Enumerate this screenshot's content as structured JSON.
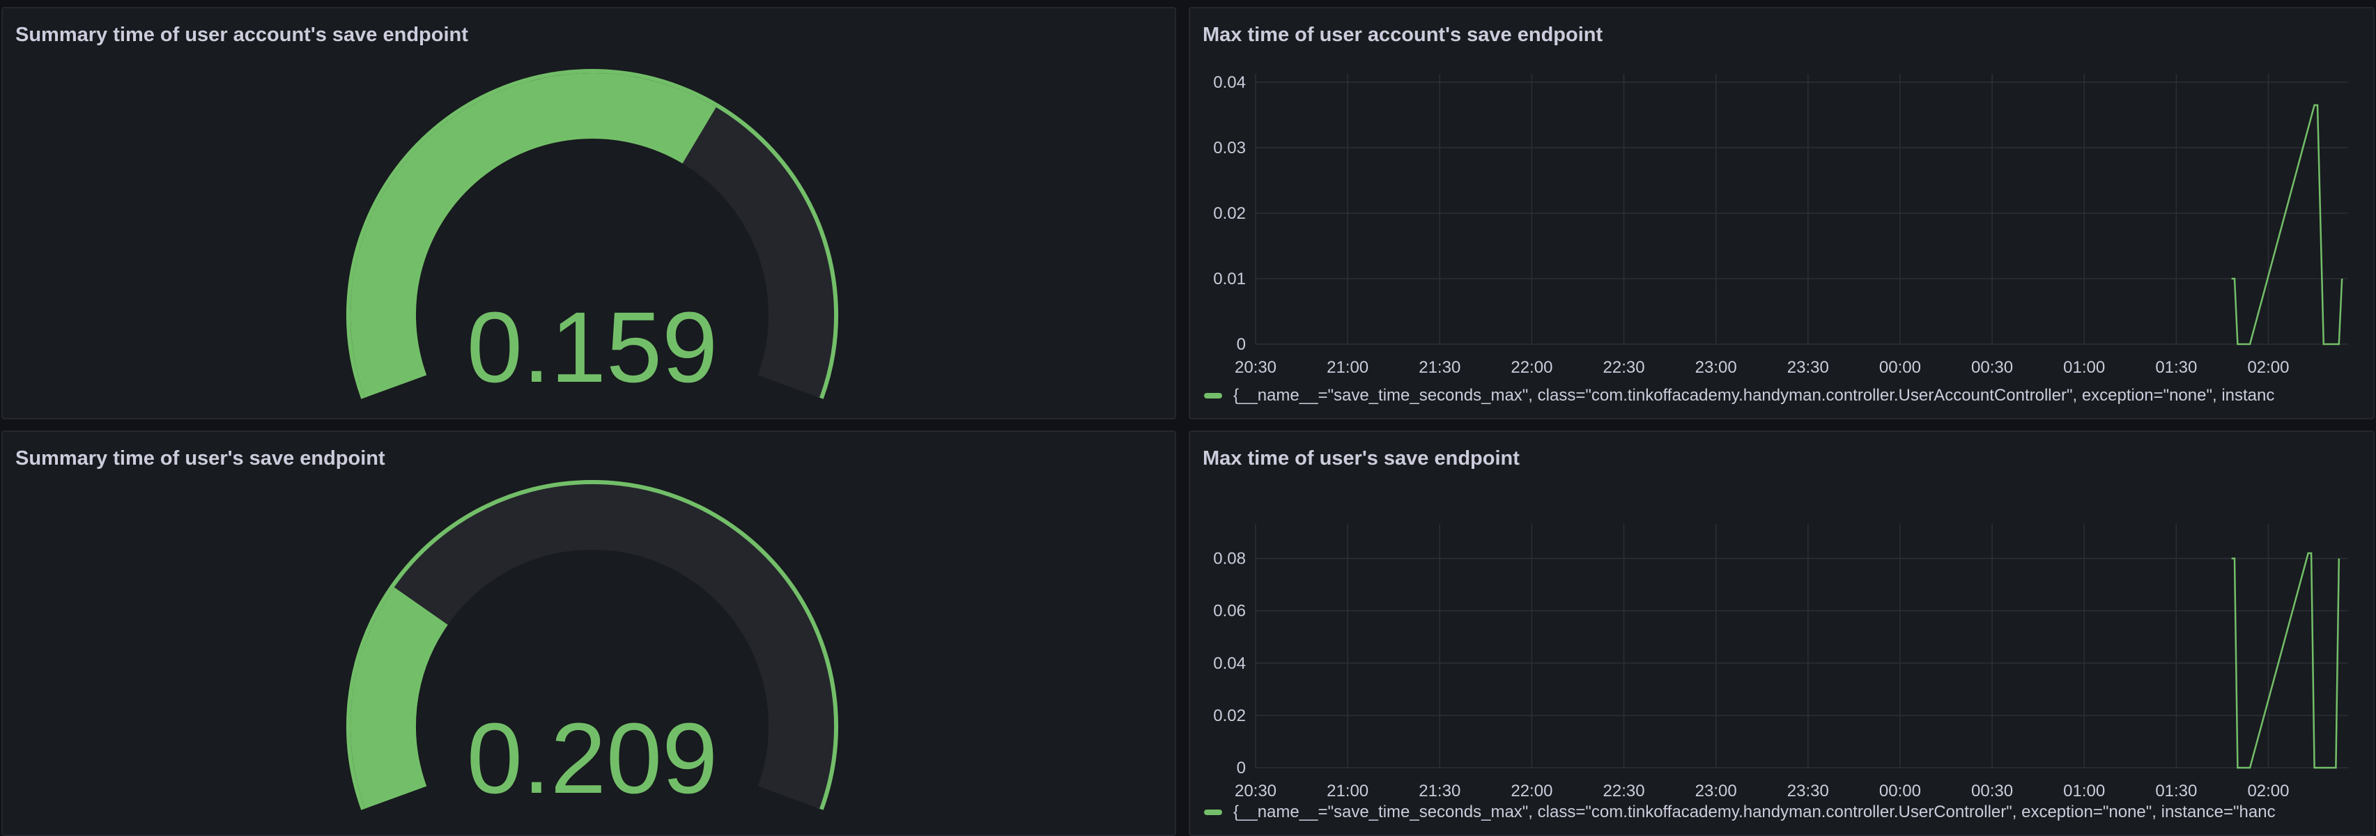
{
  "colors": {
    "background": "#111217",
    "panel": "#181b1f",
    "accent_green": "#73bf69",
    "gauge_track": "#25262c",
    "grid": "#2c2f35",
    "text": "#ccccdc"
  },
  "gauges": [
    {
      "title": "Summary time of user account's save endpoint",
      "value": "0.159",
      "fill_fraction": 0.64
    },
    {
      "title": "Summary time of user's save endpoint",
      "value": "0.209",
      "fill_fraction": 0.25
    }
  ],
  "timeseries": [
    {
      "title": "Max time of user account's save endpoint",
      "legend": "{__name__=\"save_time_seconds_max\", class=\"com.tinkoffacademy.handyman.controller.UserAccountController\", exception=\"none\", instanc",
      "chart_data": {
        "type": "line",
        "x_ticks": [
          "20:30",
          "21:00",
          "21:30",
          "22:00",
          "22:30",
          "23:00",
          "23:30",
          "00:00",
          "00:30",
          "01:00",
          "01:30",
          "02:00"
        ],
        "y_ticks": [
          "0",
          "0.01",
          "0.02",
          "0.03",
          "0.04"
        ],
        "ylim": [
          0,
          0.04
        ],
        "xlim": [
          "20:30",
          "02:26"
        ],
        "series": [
          {
            "values": [
              [
                "01:48",
                0.01
              ],
              [
                "01:49",
                0.01
              ],
              [
                "01:50",
                0
              ],
              [
                "01:54",
                0
              ],
              [
                "02:15",
                0.0365
              ],
              [
                "02:16",
                0.0365
              ],
              [
                "02:18",
                0
              ],
              [
                "02:23",
                0
              ],
              [
                "02:24",
                0.01
              ]
            ]
          }
        ]
      }
    },
    {
      "title": "Max time of user's save endpoint",
      "legend": "{__name__=\"save_time_seconds_max\", class=\"com.tinkoffacademy.handyman.controller.UserController\", exception=\"none\", instance=\"hanc",
      "chart_data": {
        "type": "line",
        "x_ticks": [
          "20:30",
          "21:00",
          "21:30",
          "22:00",
          "22:30",
          "23:00",
          "23:30",
          "00:00",
          "00:30",
          "01:00",
          "01:30",
          "02:00"
        ],
        "y_ticks": [
          "0",
          "0.02",
          "0.04",
          "0.06",
          "0.08"
        ],
        "ylim": [
          0,
          0.09
        ],
        "xlim": [
          "20:30",
          "02:26"
        ],
        "series": [
          {
            "values": [
              [
                "01:48",
                0.08
              ],
              [
                "01:49",
                0.08
              ],
              [
                "01:50",
                0
              ],
              [
                "01:54",
                0
              ],
              [
                "02:13",
                0.082
              ],
              [
                "02:14",
                0.082
              ],
              [
                "02:15",
                0
              ],
              [
                "02:22",
                0
              ],
              [
                "02:23",
                0.08
              ]
            ]
          }
        ]
      }
    }
  ]
}
